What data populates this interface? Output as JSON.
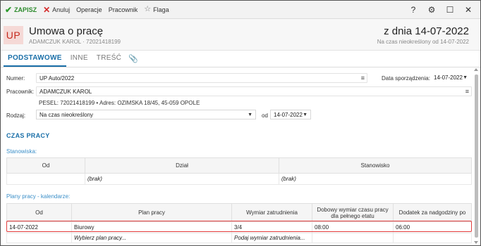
{
  "toolbar": {
    "save": "ZAPISZ",
    "cancel": "Anuluj",
    "operations": "Operacje",
    "employee": "Pracownik",
    "flag": "Flaga",
    "help": "?",
    "settings_icon": "gear-icon",
    "window_icon": "maximize-icon",
    "close_icon": "close-icon"
  },
  "header": {
    "badge": "UP",
    "title": "Umowa o pracę",
    "subtitle": "ADAMCZUK KAROL · 72021418199",
    "date_title": "z dnia 14-07-2022",
    "date_subtitle": "Na czas nieokreślony od 14-07-2022"
  },
  "tabs": {
    "basic": "PODSTAWOWE",
    "other": "INNE",
    "content": "TREŚĆ",
    "attachment_icon": "paperclip-icon"
  },
  "form": {
    "number_label": "Numer:",
    "number_value": "UP Auto/2022",
    "prep_date_label": "Data sporządzenia:",
    "prep_date_value": "14-07-2022",
    "employee_label": "Pracownik:",
    "employee_value": "ADAMCZUK KAROL",
    "employee_info": "PESEL: 72021418199  •  Adres: OZIMSKA 18/45, 45-059 OPOLE",
    "type_label": "Rodzaj:",
    "type_value": "Na czas nieokreślony",
    "from_label": "od",
    "from_value": "14-07-2022"
  },
  "work_time": {
    "section_title": "CZAS PRACY",
    "positions": {
      "title": "Stanowiska:",
      "headers": [
        "Od",
        "Dział",
        "Stanowisko"
      ],
      "placeholders": [
        "",
        "(brak)",
        "(brak)"
      ]
    },
    "plans": {
      "title": "Plany pracy - kalendarze:",
      "headers": [
        "Od",
        "Plan pracy",
        "Wymiar zatrudnienia",
        "Dobowy wymiar czasu pracy dla pełnego etatu",
        "Dodatek za nadgodziny po"
      ],
      "rows": [
        [
          "14-07-2022",
          "Biurowy",
          "3/4",
          "08:00",
          "06:00"
        ]
      ],
      "placeholders": [
        "",
        "Wybierz plan pracy...",
        "Podaj wymiar zatrudnienia...",
        "",
        ""
      ]
    }
  },
  "colors": {
    "accent": "#1a6fa8",
    "save_green": "#2e9a2e",
    "cancel_red": "#d42a2a",
    "badge_bg": "#f5d9d6",
    "badge_fg": "#c5281c",
    "highlight": "#e33d3d"
  }
}
